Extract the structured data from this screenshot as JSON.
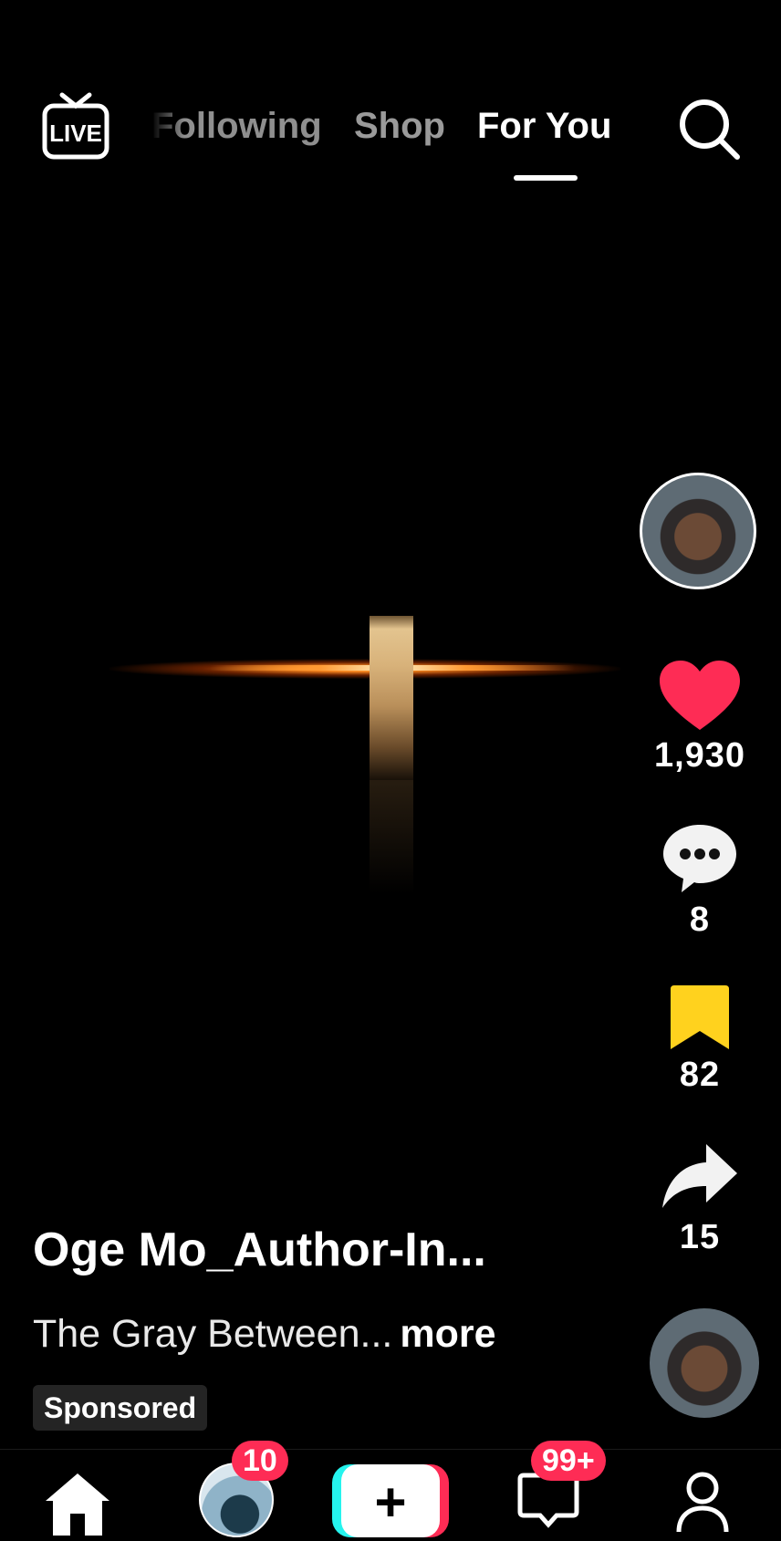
{
  "top_nav": {
    "live_label": "LIVE",
    "tabs": [
      {
        "label": "Following"
      },
      {
        "label": "Shop"
      },
      {
        "label": "For You",
        "active": true
      }
    ],
    "search_icon": "search-icon"
  },
  "actions": {
    "likes": "1,930",
    "comments": "8",
    "saves": "82",
    "shares": "15",
    "like_color": "#fe2c55",
    "save_color": "#ffd21e"
  },
  "post": {
    "username": "Oge Mo_Author-In...",
    "caption": "The Gray Between...",
    "more_label": "more",
    "sponsored_label": "Sponsored"
  },
  "bottom_nav": {
    "friends_badge": "10",
    "create_label": "+",
    "inbox_badge": "99+",
    "accent_red": "#fe2c55",
    "accent_cyan": "#25f4ee"
  }
}
